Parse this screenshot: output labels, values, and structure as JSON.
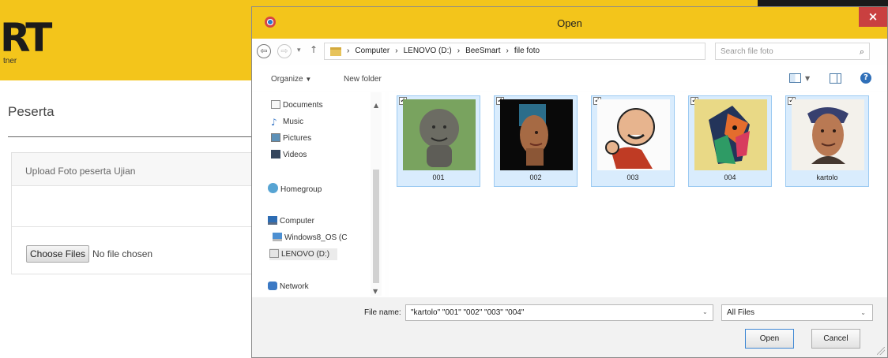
{
  "page": {
    "logo_mark": "RT",
    "logo_sub": "tner",
    "title": "Peserta",
    "upload_heading": "Upload Foto peserta Ujian",
    "choose_files": "Choose Files",
    "no_file": "No file chosen"
  },
  "dialog": {
    "title": "Open",
    "close": "×",
    "back_icon": "⇦",
    "forward_icon": "⇨",
    "recent_icon": "▾",
    "up_icon": "↑",
    "breadcrumbs": [
      "Computer",
      "LENOVO (D:)",
      "BeeSmart",
      "file foto"
    ],
    "breadcrumb_separator": "›",
    "address_dropdown": "⌄",
    "refresh_icon": "↻",
    "search_placeholder": "Search file foto",
    "search_icon": "⌕",
    "toolbar": {
      "organize": "Organize",
      "organize_arrow": "▼",
      "new_folder": "New folder",
      "view_dropdown": "▼",
      "help": "?"
    },
    "nav": {
      "items": [
        {
          "label": "Documents",
          "icon": "document-icon"
        },
        {
          "label": "Music",
          "icon": "music-icon"
        },
        {
          "label": "Pictures",
          "icon": "pictures-icon"
        },
        {
          "label": "Videos",
          "icon": "videos-icon"
        },
        {
          "label": "Homegroup",
          "icon": "homegroup-icon"
        },
        {
          "label": "Computer",
          "icon": "computer-icon"
        },
        {
          "label": "Windows8_OS (C",
          "icon": "windows-drive-icon"
        },
        {
          "label": "LENOVO (D:)",
          "icon": "drive-icon"
        },
        {
          "label": "Network",
          "icon": "network-icon"
        }
      ],
      "music_glyph": "♪",
      "scroll_up": "▲",
      "scroll_down": "▼"
    },
    "files": [
      {
        "name": "001",
        "checked": "✓"
      },
      {
        "name": "002",
        "checked": "✓"
      },
      {
        "name": "003",
        "checked": "✓"
      },
      {
        "name": "004",
        "checked": "✓"
      },
      {
        "name": "kartolo",
        "checked": "✓"
      }
    ],
    "file_name_label": "File name:",
    "file_name_value": "\"kartolo\" \"001\" \"002\" \"003\" \"004\"",
    "file_name_dropdown": "⌄",
    "file_type": "All Files",
    "file_type_arrow": "⌄",
    "open_button": "Open",
    "cancel_button": "Cancel"
  },
  "colors": {
    "brand_yellow": "#f3c51b",
    "selection_blue": "#d9ecfd",
    "selection_border": "#9ccaf2"
  }
}
